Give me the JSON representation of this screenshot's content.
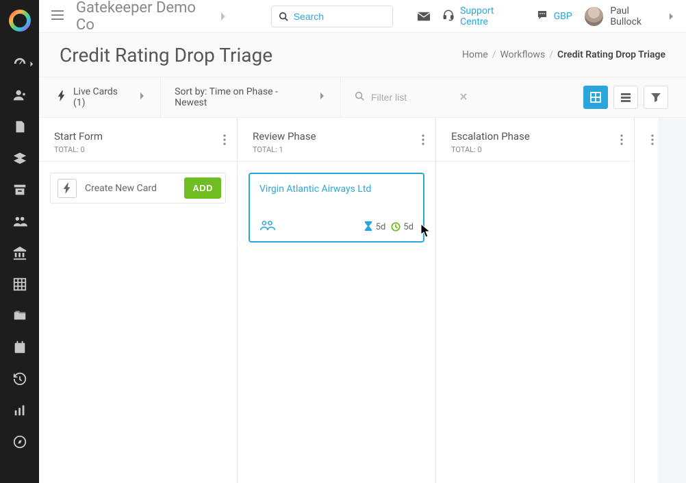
{
  "header": {
    "company_name": "Gatekeeper Demo Co",
    "search_placeholder": "Search",
    "support_label": "Support Centre",
    "currency": "GBP",
    "user_name": "Paul Bullock"
  },
  "page": {
    "title": "Credit Rating Drop Triage"
  },
  "breadcrumb": {
    "home": "Home",
    "workflows": "Workflows",
    "current": "Credit Rating Drop Triage"
  },
  "toolbar": {
    "live_cards_label": "Live Cards (1)",
    "sort_label": "Sort by: Time on Phase - Newest",
    "filter_placeholder": "Filter list"
  },
  "columns": [
    {
      "title": "Start Form",
      "total_label": "TOTAL: 0"
    },
    {
      "title": "Review Phase",
      "total_label": "TOTAL: 1"
    },
    {
      "title": "Escalation Phase",
      "total_label": "TOTAL: 0"
    }
  ],
  "start_form": {
    "create_label": "Create New Card",
    "add_button": "ADD"
  },
  "review_card": {
    "title": "Virgin Atlantic Airways Ltd",
    "phase_time": "5d",
    "total_time": "5d"
  }
}
